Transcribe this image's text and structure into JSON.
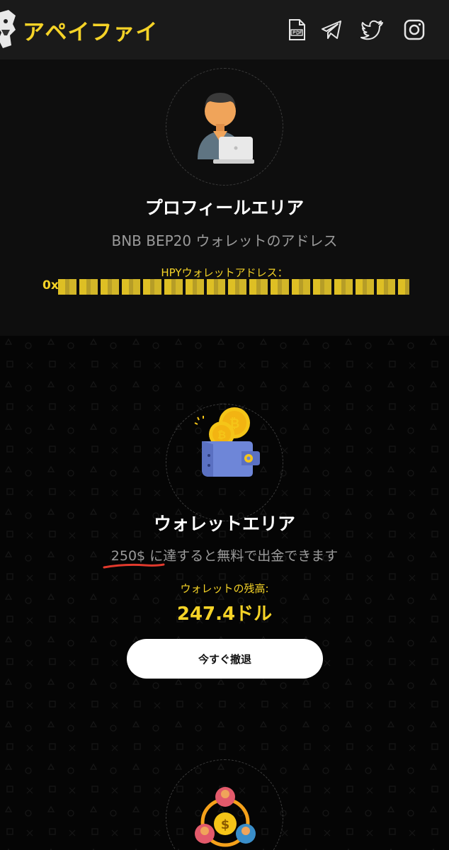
{
  "header": {
    "brand": "アペイファイ",
    "icons": [
      "pdf-icon",
      "telegram-icon",
      "twitter-icon",
      "instagram-icon"
    ],
    "brand_color": "#f5d327"
  },
  "profile": {
    "title": "プロフィールエリア",
    "subtitle_prefix": "BNB BEP20",
    "subtitle_suffix": " ウォレットのアドレス",
    "address_label": "HPYウォレットアドレス：",
    "address_value": "0x"
  },
  "wallet": {
    "title": "ウォレットエリア",
    "limit_amount": "250$",
    "limit_text": " に達すると無料で出金できます",
    "balance_label": "ウォレットの残高:",
    "balance_value": "247.4ドル",
    "withdraw_label": "今すぐ撤退"
  }
}
